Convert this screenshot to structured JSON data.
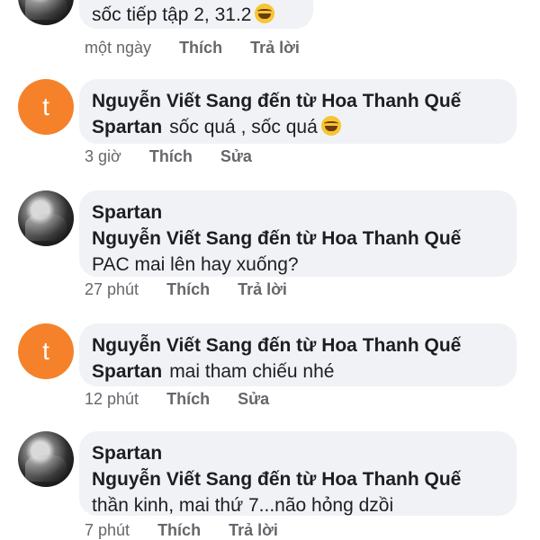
{
  "comments": [
    {
      "avatar": "photo",
      "lines": [
        "sốc tiếp tập 2, 31.2"
      ],
      "emoji": "laughing-emoji",
      "time": "một ngày",
      "actions": [
        "Thích",
        "Trả lời"
      ]
    },
    {
      "avatar": "letter",
      "avatar_letter": "t",
      "author": "Nguyễn Viết Sang đến từ Hoa Thanh Quế",
      "mention": "Spartan",
      "text": "sốc quá , sốc quá",
      "emoji": "laughing-emoji",
      "time": "3 giờ",
      "actions": [
        "Thích",
        "Sửa"
      ]
    },
    {
      "avatar": "photo",
      "author": "Spartan",
      "mention_line": "Nguyễn Viết Sang đến từ Hoa Thanh Quế",
      "text": "PAC mai lên hay xuống?",
      "time": "27 phút",
      "actions": [
        "Thích",
        "Trả lời"
      ]
    },
    {
      "avatar": "letter",
      "avatar_letter": "t",
      "author": "Nguyễn Viết Sang đến từ Hoa Thanh Quế",
      "mention": "Spartan",
      "text": "mai tham chiếu nhé",
      "time": "12 phút",
      "actions": [
        "Thích",
        "Sửa"
      ]
    },
    {
      "avatar": "photo",
      "author": "Spartan",
      "mention_line": "Nguyễn Viết Sang đến từ Hoa Thanh Quế",
      "text": "thần kinh, mai thứ 7...não hỏng dzồi",
      "time": "7 phút",
      "actions": [
        "Thích",
        "Trả lời"
      ]
    }
  ]
}
